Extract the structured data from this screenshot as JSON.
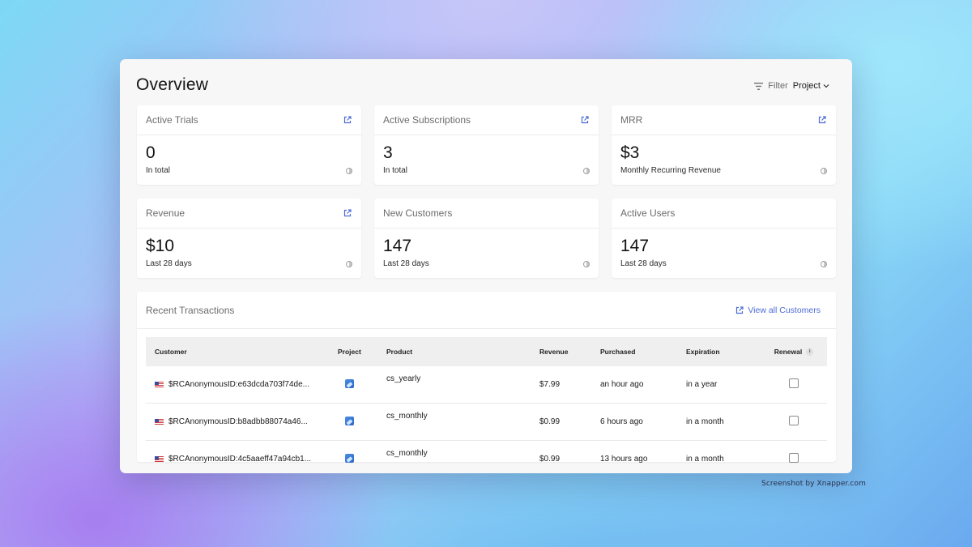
{
  "page": {
    "title": "Overview"
  },
  "filter": {
    "label": "Filter",
    "value": "Project"
  },
  "cards": [
    {
      "title": "Active Trials",
      "value": "0",
      "subtitle": "In total",
      "has_link": true
    },
    {
      "title": "Active Subscriptions",
      "value": "3",
      "subtitle": "In total",
      "has_link": true
    },
    {
      "title": "MRR",
      "value": "$3",
      "subtitle": "Monthly Recurring Revenue",
      "has_link": true
    },
    {
      "title": "Revenue",
      "value": "$10",
      "subtitle": "Last 28 days",
      "has_link": true
    },
    {
      "title": "New Customers",
      "value": "147",
      "subtitle": "Last 28 days",
      "has_link": false
    },
    {
      "title": "Active Users",
      "value": "147",
      "subtitle": "Last 28 days",
      "has_link": false
    }
  ],
  "transactions": {
    "title": "Recent Transactions",
    "view_all": "View all Customers",
    "columns": [
      "Customer",
      "Project",
      "Product",
      "Revenue",
      "Purchased",
      "Expiration",
      "Renewal"
    ],
    "info_badge": "i",
    "rows": [
      {
        "customer": "$RCAnonymousID:e63dcda703f74de...",
        "product": "cs_yearly",
        "revenue": "$7.99",
        "purchased": "an hour ago",
        "expiration": "in a year",
        "renewal": false
      },
      {
        "customer": "$RCAnonymousID:b8adbb88074a46...",
        "product": "cs_monthly",
        "revenue": "$0.99",
        "purchased": "6 hours ago",
        "expiration": "in a month",
        "renewal": false
      },
      {
        "customer": "$RCAnonymousID:4c5aaeff47a94cb1...",
        "product": "cs_monthly",
        "revenue": "$0.99",
        "purchased": "13 hours ago",
        "expiration": "in a month",
        "renewal": false
      }
    ]
  },
  "watermark": "Screenshot by Xnapper.com",
  "icons": {
    "filter": "filter-lines-icon",
    "dropdown": "chevron-down-icon",
    "external": "external-link-icon",
    "info": "info-circle-icon",
    "flag": "us-flag-icon",
    "project": "project-app-icon"
  },
  "colors": {
    "accent": "#4d6bd6",
    "window_bg": "#f7f7f7",
    "card_bg": "#ffffff"
  }
}
